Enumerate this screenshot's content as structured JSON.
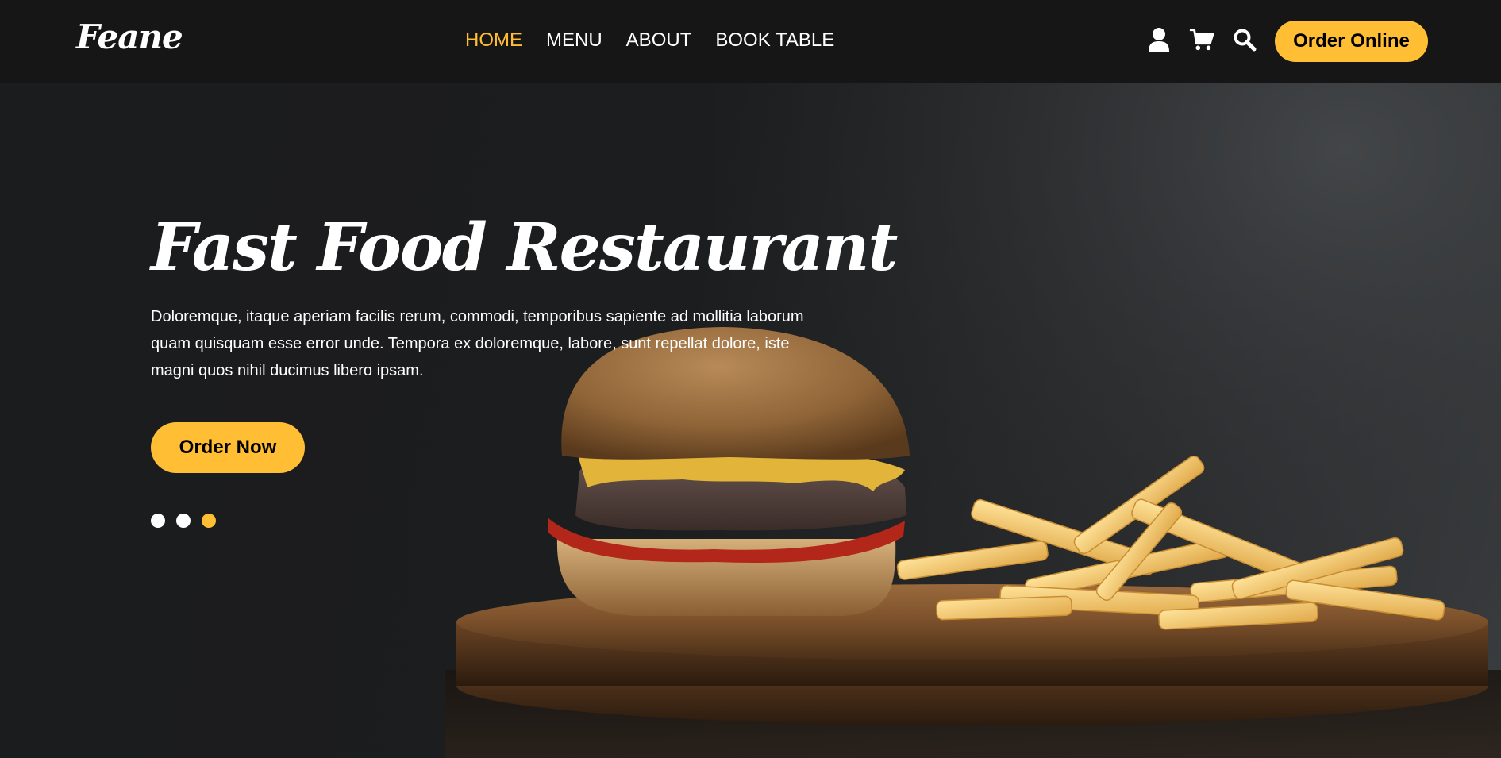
{
  "brand": {
    "logo": "Feane"
  },
  "nav": {
    "items": [
      {
        "label": "HOME",
        "active": true
      },
      {
        "label": "MENU",
        "active": false
      },
      {
        "label": "ABOUT",
        "active": false
      },
      {
        "label": "BOOK TABLE",
        "active": false
      }
    ]
  },
  "header": {
    "icons": [
      "user-icon",
      "cart-icon",
      "search-icon"
    ],
    "order_online_label": "Order Online"
  },
  "hero": {
    "title": "Fast Food Restaurant",
    "text": "Doloremque, itaque aperiam facilis rerum, commodi, temporibus sapiente ad mollitia laborum quam quisquam esse error unde. Tempora ex doloremque, labore, sunt repellat dolore, iste magni quos nihil ducimus libero ipsam.",
    "cta_label": "Order Now",
    "slides": {
      "count": 3,
      "active_index": 2
    }
  },
  "colors": {
    "accent": "#ffbe33",
    "header_bg": "#161617",
    "hero_bg": "#1d1e20"
  }
}
